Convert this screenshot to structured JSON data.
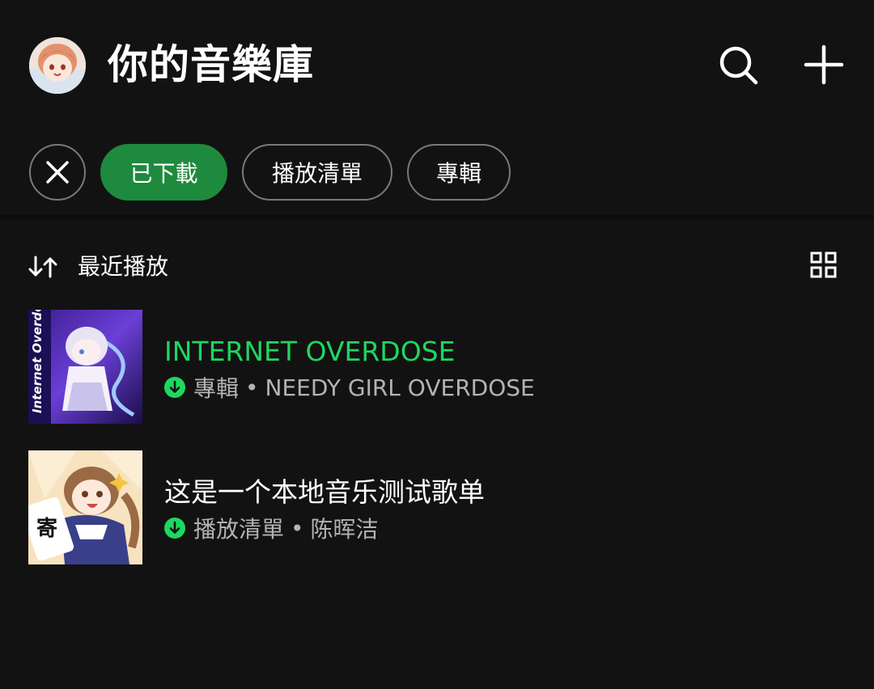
{
  "header": {
    "title": "你的音樂庫"
  },
  "filters": {
    "chips": [
      {
        "label": "已下載",
        "selected": true
      },
      {
        "label": "播放清單",
        "selected": false
      },
      {
        "label": "專輯",
        "selected": false
      }
    ]
  },
  "sort": {
    "label": "最近播放"
  },
  "library": {
    "items": [
      {
        "title": "INTERNET OVERDOSE",
        "type": "專輯",
        "separator": "•",
        "owner": "NEEDY GIRL OVERDOSE",
        "downloaded": true,
        "playing": true,
        "cover_text": "Internet Overdose"
      },
      {
        "title": "这是一个本地音乐测试歌单",
        "type": "播放清單",
        "separator": "•",
        "owner": "陈晖洁",
        "downloaded": true,
        "playing": false,
        "cover_text": "寄"
      }
    ]
  },
  "colors": {
    "background": "#121212",
    "accent_green": "#1ed760",
    "chip_selected": "#1e8a3e",
    "secondary_text": "#b3b3b3"
  }
}
